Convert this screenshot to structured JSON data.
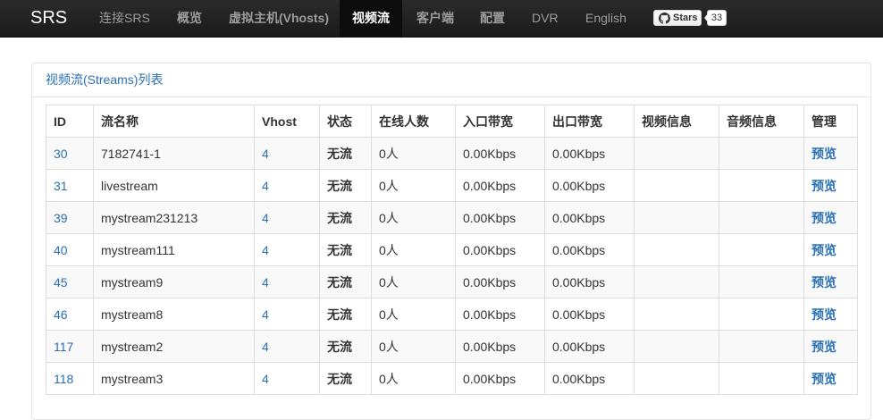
{
  "navbar": {
    "brand": "SRS",
    "items": [
      {
        "label": "连接SRS"
      },
      {
        "label": "概览"
      },
      {
        "label": "虚拟主机(Vhosts)"
      },
      {
        "label": "视频流"
      },
      {
        "label": "客户端"
      },
      {
        "label": "配置"
      },
      {
        "label": "DVR"
      },
      {
        "label": "English"
      }
    ],
    "github": {
      "label": "Stars",
      "count": "33"
    }
  },
  "panel": {
    "title": "视频流(Streams)列表"
  },
  "table": {
    "headers": [
      "ID",
      "流名称",
      "Vhost",
      "状态",
      "在线人数",
      "入口带宽",
      "出口带宽",
      "视频信息",
      "音频信息",
      "管理"
    ],
    "rows": [
      {
        "id": "30",
        "name": "7182741-1",
        "vhost": "4",
        "status": "无流",
        "clients": "0人",
        "in_bw": "0.00Kbps",
        "out_bw": "0.00Kbps",
        "video": "",
        "audio": "",
        "action": "预览"
      },
      {
        "id": "31",
        "name": "livestream",
        "vhost": "4",
        "status": "无流",
        "clients": "0人",
        "in_bw": "0.00Kbps",
        "out_bw": "0.00Kbps",
        "video": "",
        "audio": "",
        "action": "预览"
      },
      {
        "id": "39",
        "name": "mystream231213",
        "vhost": "4",
        "status": "无流",
        "clients": "0人",
        "in_bw": "0.00Kbps",
        "out_bw": "0.00Kbps",
        "video": "",
        "audio": "",
        "action": "预览"
      },
      {
        "id": "40",
        "name": "mystream111",
        "vhost": "4",
        "status": "无流",
        "clients": "0人",
        "in_bw": "0.00Kbps",
        "out_bw": "0.00Kbps",
        "video": "",
        "audio": "",
        "action": "预览"
      },
      {
        "id": "45",
        "name": "mystream9",
        "vhost": "4",
        "status": "无流",
        "clients": "0人",
        "in_bw": "0.00Kbps",
        "out_bw": "0.00Kbps",
        "video": "",
        "audio": "",
        "action": "预览"
      },
      {
        "id": "46",
        "name": "mystream8",
        "vhost": "4",
        "status": "无流",
        "clients": "0人",
        "in_bw": "0.00Kbps",
        "out_bw": "0.00Kbps",
        "video": "",
        "audio": "",
        "action": "预览"
      },
      {
        "id": "117",
        "name": "mystream2",
        "vhost": "4",
        "status": "无流",
        "clients": "0人",
        "in_bw": "0.00Kbps",
        "out_bw": "0.00Kbps",
        "video": "",
        "audio": "",
        "action": "预览"
      },
      {
        "id": "118",
        "name": "mystream3",
        "vhost": "4",
        "status": "无流",
        "clients": "0人",
        "in_bw": "0.00Kbps",
        "out_bw": "0.00Kbps",
        "video": "",
        "audio": "",
        "action": "预览"
      }
    ]
  },
  "colors": {
    "navbar_bg": "#222222",
    "link": "#2a6fb3",
    "row_stripe": "#f9f9f9",
    "border": "#dddddd"
  },
  "icons": {
    "github": "github-icon"
  }
}
